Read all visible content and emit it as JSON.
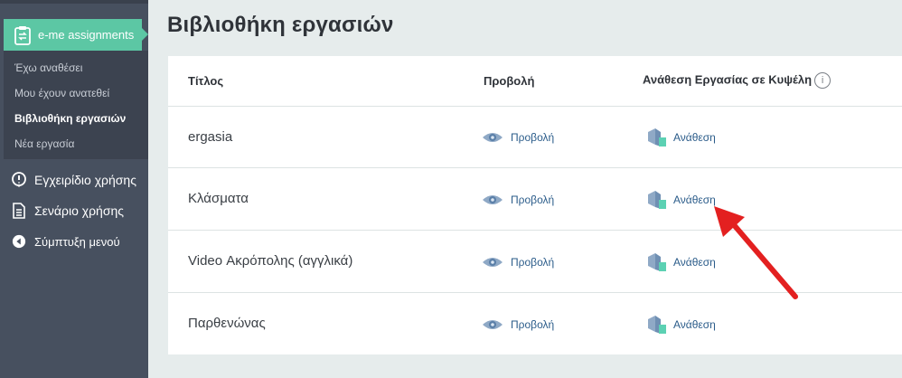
{
  "sidebar": {
    "app_title": "e-me assignments",
    "sub_items": [
      "Έχω αναθέσει",
      "Μου έχουν ανατεθεί",
      "Βιβλιοθήκη εργασιών",
      "Νέα εργασία"
    ],
    "nav_items": [
      "Εγχειρίδιο χρήσης",
      "Σενάριο χρήσης",
      "Σύμπτυξη μενού"
    ],
    "icons": [
      "clipboard-icon",
      "info-pin-icon",
      "document-icon",
      "collapse-icon"
    ]
  },
  "main": {
    "title": "Βιβλιοθήκη εργασιών",
    "columns": [
      "Τίτλος",
      "Προβολή",
      "Ανάθεση Εργασίας σε Κυψέλη"
    ],
    "info_glyph": "i",
    "rows": [
      {
        "title": "ergasia",
        "view": "Προβολή",
        "assign": "Ανάθεση"
      },
      {
        "title": "Κλάσματα",
        "view": "Προβολή",
        "assign": "Ανάθεση"
      },
      {
        "title": "Video Ακρόπολης (αγγλικά)",
        "view": "Προβολή",
        "assign": "Ανάθεση"
      },
      {
        "title": "Παρθενώνας",
        "view": "Προβολή",
        "assign": "Ανάθεση"
      }
    ]
  },
  "colors": {
    "sidebar": "#47505f",
    "accent": "#5cc7a4",
    "link": "#2b5c8a",
    "annotation_arrow": "#e32020"
  }
}
